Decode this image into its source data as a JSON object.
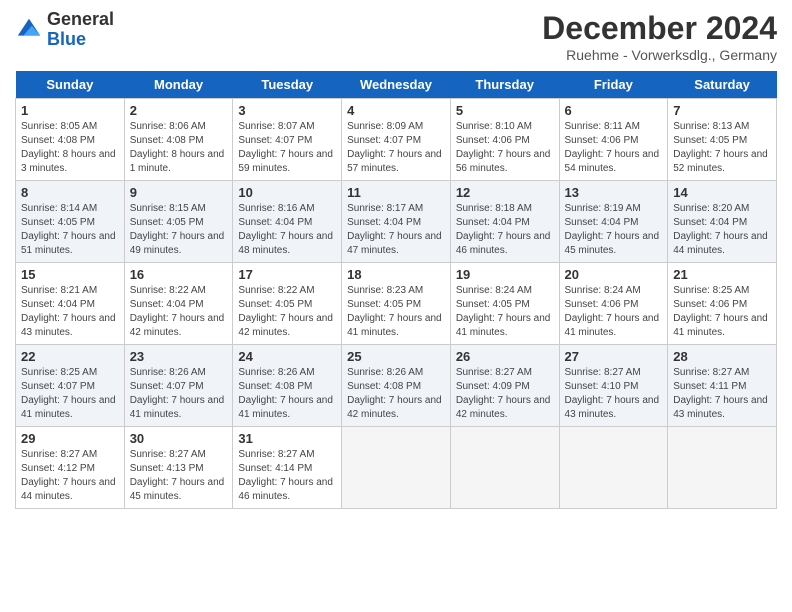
{
  "logo": {
    "general": "General",
    "blue": "Blue"
  },
  "title": "December 2024",
  "subtitle": "Ruehme - Vorwerksdlg., Germany",
  "headers": [
    "Sunday",
    "Monday",
    "Tuesday",
    "Wednesday",
    "Thursday",
    "Friday",
    "Saturday"
  ],
  "weeks": [
    [
      {
        "day": "1",
        "sunrise": "Sunrise: 8:05 AM",
        "sunset": "Sunset: 4:08 PM",
        "daylight": "Daylight: 8 hours and 3 minutes."
      },
      {
        "day": "2",
        "sunrise": "Sunrise: 8:06 AM",
        "sunset": "Sunset: 4:08 PM",
        "daylight": "Daylight: 8 hours and 1 minute."
      },
      {
        "day": "3",
        "sunrise": "Sunrise: 8:07 AM",
        "sunset": "Sunset: 4:07 PM",
        "daylight": "Daylight: 7 hours and 59 minutes."
      },
      {
        "day": "4",
        "sunrise": "Sunrise: 8:09 AM",
        "sunset": "Sunset: 4:07 PM",
        "daylight": "Daylight: 7 hours and 57 minutes."
      },
      {
        "day": "5",
        "sunrise": "Sunrise: 8:10 AM",
        "sunset": "Sunset: 4:06 PM",
        "daylight": "Daylight: 7 hours and 56 minutes."
      },
      {
        "day": "6",
        "sunrise": "Sunrise: 8:11 AM",
        "sunset": "Sunset: 4:06 PM",
        "daylight": "Daylight: 7 hours and 54 minutes."
      },
      {
        "day": "7",
        "sunrise": "Sunrise: 8:13 AM",
        "sunset": "Sunset: 4:05 PM",
        "daylight": "Daylight: 7 hours and 52 minutes."
      }
    ],
    [
      {
        "day": "8",
        "sunrise": "Sunrise: 8:14 AM",
        "sunset": "Sunset: 4:05 PM",
        "daylight": "Daylight: 7 hours and 51 minutes."
      },
      {
        "day": "9",
        "sunrise": "Sunrise: 8:15 AM",
        "sunset": "Sunset: 4:05 PM",
        "daylight": "Daylight: 7 hours and 49 minutes."
      },
      {
        "day": "10",
        "sunrise": "Sunrise: 8:16 AM",
        "sunset": "Sunset: 4:04 PM",
        "daylight": "Daylight: 7 hours and 48 minutes."
      },
      {
        "day": "11",
        "sunrise": "Sunrise: 8:17 AM",
        "sunset": "Sunset: 4:04 PM",
        "daylight": "Daylight: 7 hours and 47 minutes."
      },
      {
        "day": "12",
        "sunrise": "Sunrise: 8:18 AM",
        "sunset": "Sunset: 4:04 PM",
        "daylight": "Daylight: 7 hours and 46 minutes."
      },
      {
        "day": "13",
        "sunrise": "Sunrise: 8:19 AM",
        "sunset": "Sunset: 4:04 PM",
        "daylight": "Daylight: 7 hours and 45 minutes."
      },
      {
        "day": "14",
        "sunrise": "Sunrise: 8:20 AM",
        "sunset": "Sunset: 4:04 PM",
        "daylight": "Daylight: 7 hours and 44 minutes."
      }
    ],
    [
      {
        "day": "15",
        "sunrise": "Sunrise: 8:21 AM",
        "sunset": "Sunset: 4:04 PM",
        "daylight": "Daylight: 7 hours and 43 minutes."
      },
      {
        "day": "16",
        "sunrise": "Sunrise: 8:22 AM",
        "sunset": "Sunset: 4:04 PM",
        "daylight": "Daylight: 7 hours and 42 minutes."
      },
      {
        "day": "17",
        "sunrise": "Sunrise: 8:22 AM",
        "sunset": "Sunset: 4:05 PM",
        "daylight": "Daylight: 7 hours and 42 minutes."
      },
      {
        "day": "18",
        "sunrise": "Sunrise: 8:23 AM",
        "sunset": "Sunset: 4:05 PM",
        "daylight": "Daylight: 7 hours and 41 minutes."
      },
      {
        "day": "19",
        "sunrise": "Sunrise: 8:24 AM",
        "sunset": "Sunset: 4:05 PM",
        "daylight": "Daylight: 7 hours and 41 minutes."
      },
      {
        "day": "20",
        "sunrise": "Sunrise: 8:24 AM",
        "sunset": "Sunset: 4:06 PM",
        "daylight": "Daylight: 7 hours and 41 minutes."
      },
      {
        "day": "21",
        "sunrise": "Sunrise: 8:25 AM",
        "sunset": "Sunset: 4:06 PM",
        "daylight": "Daylight: 7 hours and 41 minutes."
      }
    ],
    [
      {
        "day": "22",
        "sunrise": "Sunrise: 8:25 AM",
        "sunset": "Sunset: 4:07 PM",
        "daylight": "Daylight: 7 hours and 41 minutes."
      },
      {
        "day": "23",
        "sunrise": "Sunrise: 8:26 AM",
        "sunset": "Sunset: 4:07 PM",
        "daylight": "Daylight: 7 hours and 41 minutes."
      },
      {
        "day": "24",
        "sunrise": "Sunrise: 8:26 AM",
        "sunset": "Sunset: 4:08 PM",
        "daylight": "Daylight: 7 hours and 41 minutes."
      },
      {
        "day": "25",
        "sunrise": "Sunrise: 8:26 AM",
        "sunset": "Sunset: 4:08 PM",
        "daylight": "Daylight: 7 hours and 42 minutes."
      },
      {
        "day": "26",
        "sunrise": "Sunrise: 8:27 AM",
        "sunset": "Sunset: 4:09 PM",
        "daylight": "Daylight: 7 hours and 42 minutes."
      },
      {
        "day": "27",
        "sunrise": "Sunrise: 8:27 AM",
        "sunset": "Sunset: 4:10 PM",
        "daylight": "Daylight: 7 hours and 43 minutes."
      },
      {
        "day": "28",
        "sunrise": "Sunrise: 8:27 AM",
        "sunset": "Sunset: 4:11 PM",
        "daylight": "Daylight: 7 hours and 43 minutes."
      }
    ],
    [
      {
        "day": "29",
        "sunrise": "Sunrise: 8:27 AM",
        "sunset": "Sunset: 4:12 PM",
        "daylight": "Daylight: 7 hours and 44 minutes."
      },
      {
        "day": "30",
        "sunrise": "Sunrise: 8:27 AM",
        "sunset": "Sunset: 4:13 PM",
        "daylight": "Daylight: 7 hours and 45 minutes."
      },
      {
        "day": "31",
        "sunrise": "Sunrise: 8:27 AM",
        "sunset": "Sunset: 4:14 PM",
        "daylight": "Daylight: 7 hours and 46 minutes."
      },
      null,
      null,
      null,
      null
    ]
  ]
}
